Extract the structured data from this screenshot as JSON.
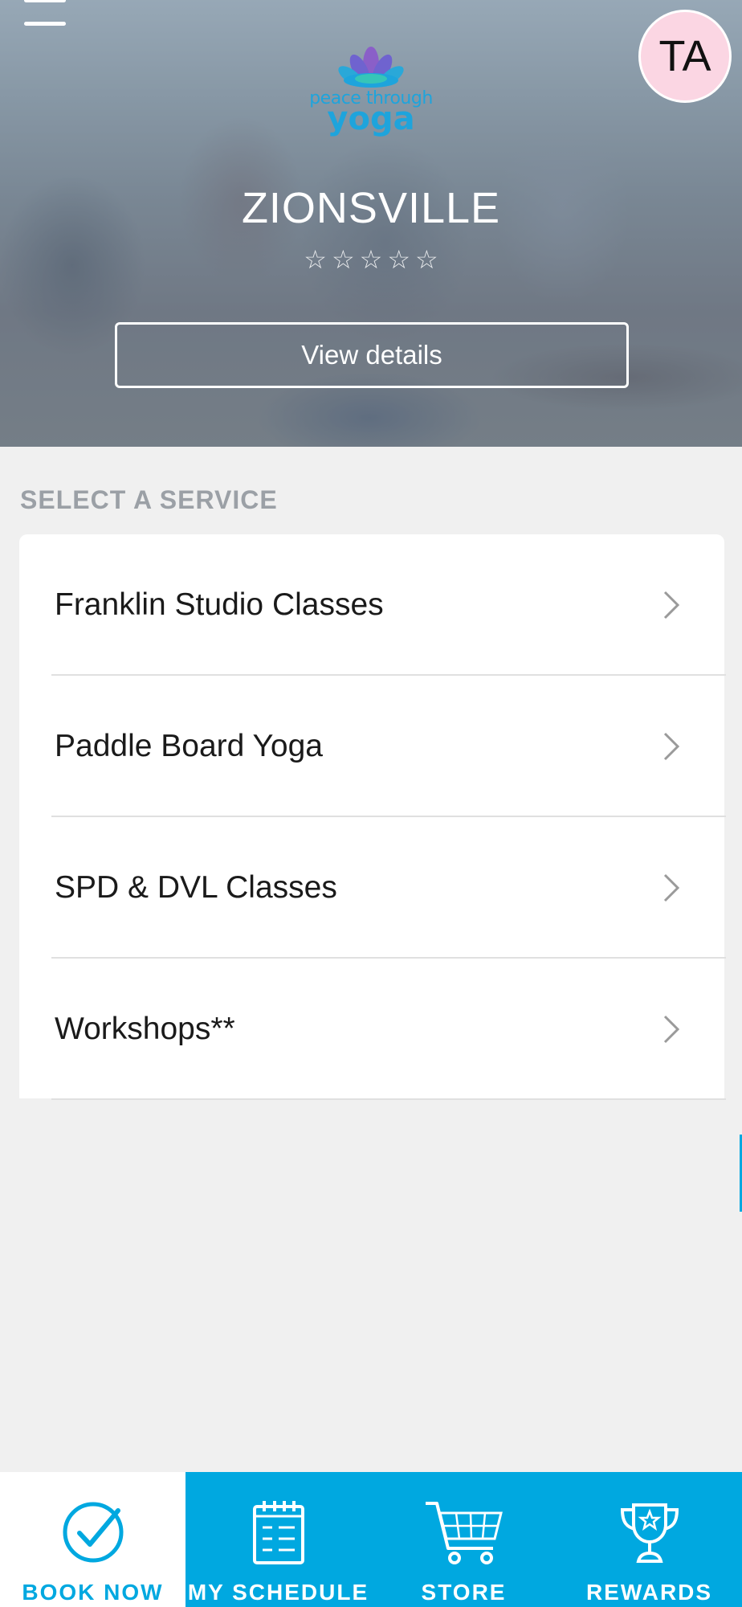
{
  "header": {
    "menu_icon": "hamburger-icon",
    "avatar_initials": "TA",
    "avatar_color": "#fbd6e3",
    "logo": {
      "line1": "peace through",
      "line2": "yoga"
    },
    "location_title": "ZIONSVILLE",
    "rating": {
      "value": 0,
      "max": 5,
      "icon": "star-outline-icon"
    },
    "view_details_label": "View details"
  },
  "services": {
    "section_label": "SELECT A SERVICE",
    "items": [
      {
        "label": "Franklin Studio Classes"
      },
      {
        "label": "Paddle Board Yoga"
      },
      {
        "label": "SPD & DVL Classes"
      },
      {
        "label": "Workshops**"
      }
    ],
    "chevron_icon": "chevron-right-icon"
  },
  "bottom_nav": {
    "accent": "#00a8e0",
    "active_index": 0,
    "items": [
      {
        "label": "BOOK NOW",
        "icon": "check-circle-icon"
      },
      {
        "label": "MY SCHEDULE",
        "icon": "calendar-icon"
      },
      {
        "label": "STORE",
        "icon": "cart-icon"
      },
      {
        "label": "REWARDS",
        "icon": "trophy-icon"
      }
    ]
  }
}
